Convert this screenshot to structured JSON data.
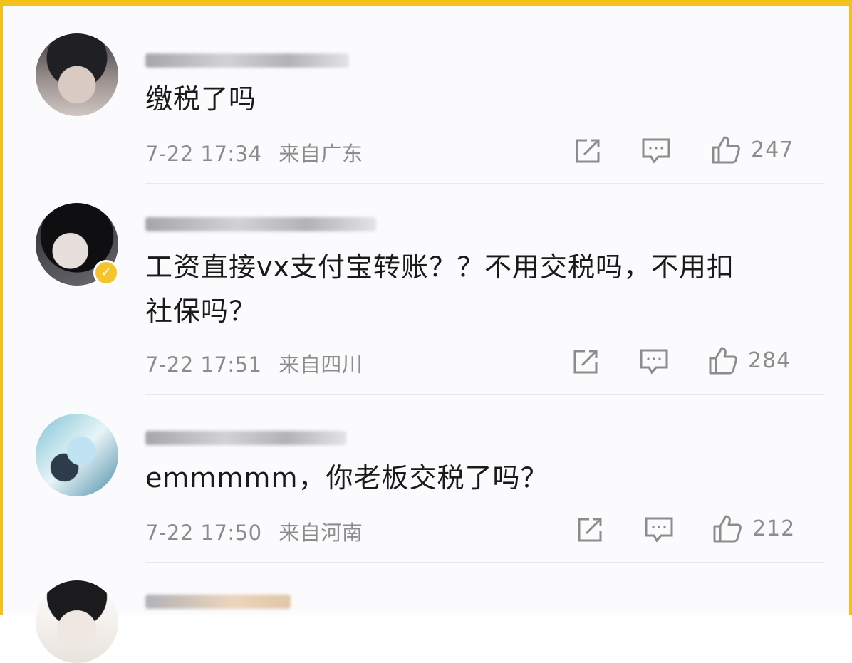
{
  "comments": [
    {
      "content": "缴税了吗",
      "date": "7-22 17:34",
      "location": "来自广东",
      "likes": "247"
    },
    {
      "content_line1": "工资直接vx支付宝转账？？不用交税吗，不用扣",
      "content_line2": "社保吗？",
      "date": "7-22 17:51",
      "location": "来自四川",
      "likes": "284"
    },
    {
      "content": "emmmmm，你老板交税了吗？",
      "date": "7-22 17:50",
      "location": "来自河南",
      "likes": "212"
    }
  ],
  "icons": {
    "share": "share-icon",
    "reply": "comment-icon",
    "like": "thumbs-up-icon",
    "verified": "verified-badge-icon"
  },
  "colors": {
    "frame": "#f2c21b",
    "text": "#1a1a1a",
    "meta": "#8c8c8c",
    "verified": "#f4c430"
  }
}
